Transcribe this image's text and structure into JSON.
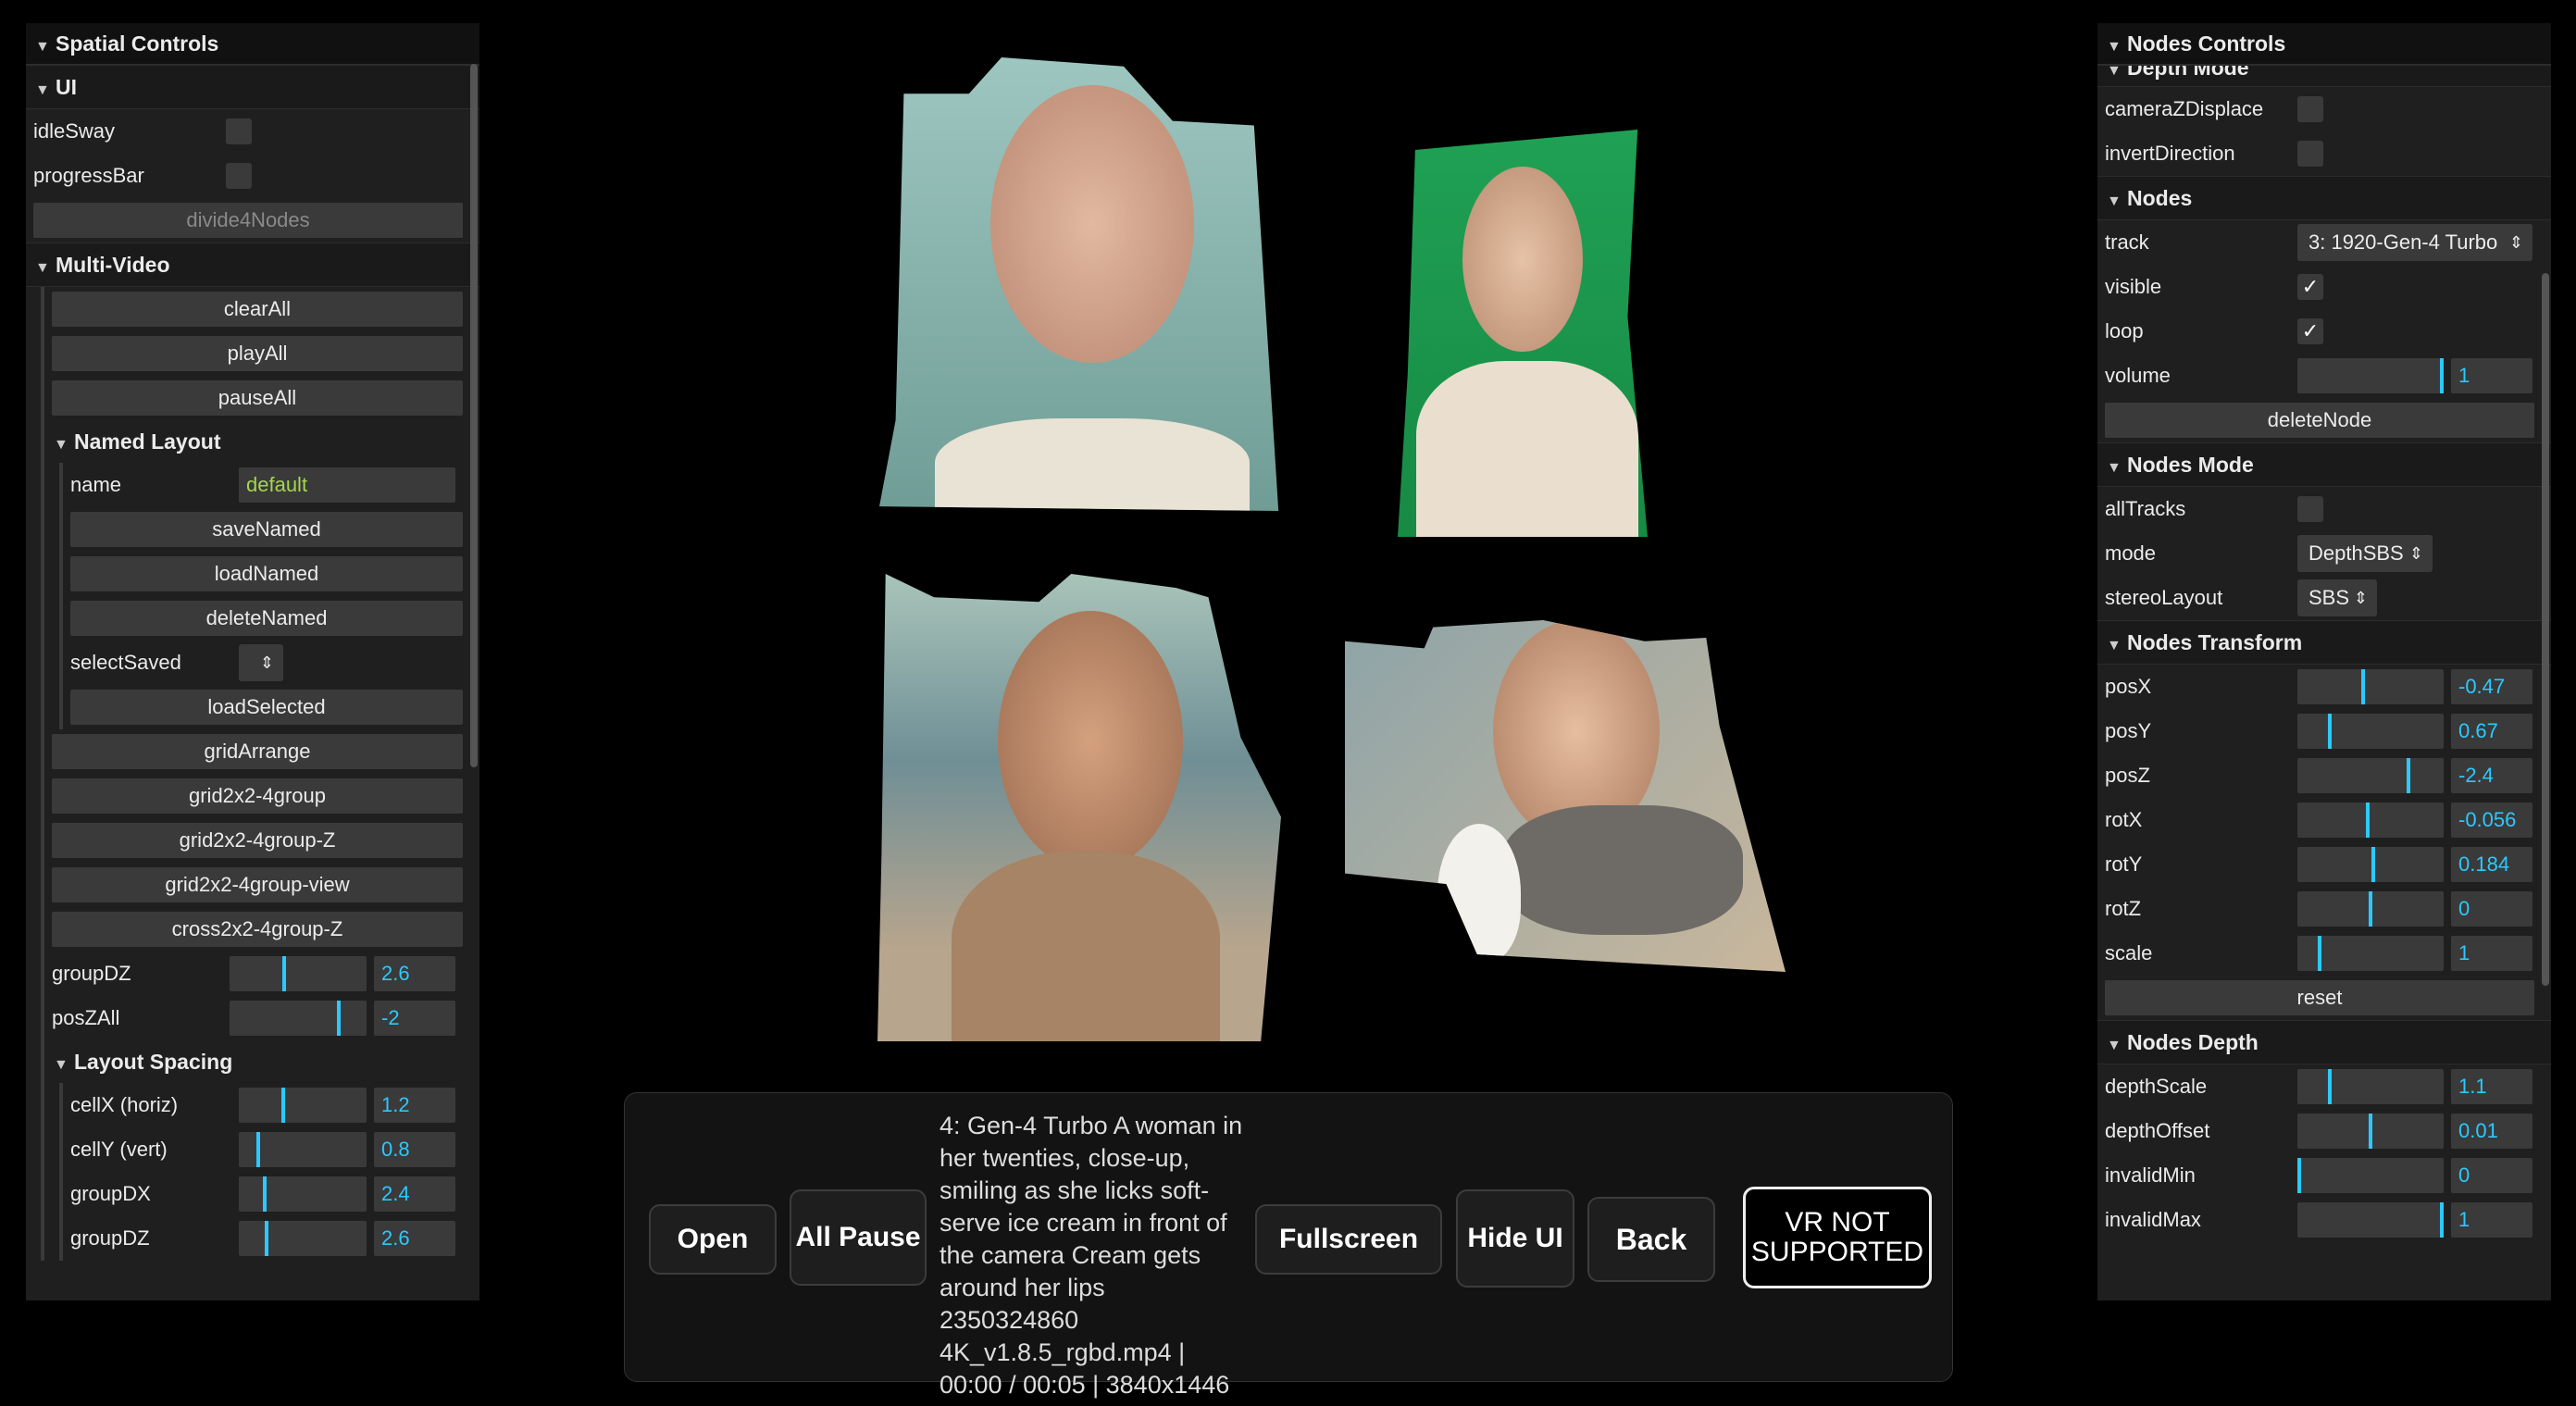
{
  "left_panel": {
    "title": "Spatial Controls",
    "ui_folder": {
      "title": "UI",
      "idleSway_label": "idleSway",
      "progressBar_label": "progressBar",
      "divide_button": "divide4Nodes"
    },
    "multi_video": {
      "title": "Multi-Video",
      "buttons": [
        "clearAll",
        "playAll",
        "pauseAll"
      ],
      "named_layout": {
        "title": "Named Layout",
        "name_label": "name",
        "name_value": "default",
        "buttons": [
          "saveNamed",
          "loadNamed",
          "deleteNamed"
        ],
        "selectSaved_label": "selectSaved",
        "load_selected": "loadSelected"
      },
      "layout_buttons": [
        "gridArrange",
        "grid2x2-4group",
        "grid2x2-4group-Z",
        "grid2x2-4group-view",
        "cross2x2-4group-Z"
      ],
      "groupDZ": {
        "label": "groupDZ",
        "value": "2.6",
        "fraction": 0.4
      },
      "posZAll": {
        "label": "posZAll",
        "value": "-2",
        "fraction": 0.8
      },
      "layout_spacing": {
        "title": "Layout Spacing",
        "rows": [
          {
            "label": "cellX (horiz)",
            "value": "1.2",
            "fraction": 0.35
          },
          {
            "label": "cellY (vert)",
            "value": "0.8",
            "fraction": 0.15
          },
          {
            "label": "groupDX",
            "value": "2.4",
            "fraction": 0.2
          },
          {
            "label": "groupDZ",
            "value": "2.6",
            "fraction": 0.22
          }
        ]
      }
    }
  },
  "right_panel": {
    "title": "Nodes Controls",
    "depth_mode_title": "Depth Mode",
    "cameraZDisplace_label": "cameraZDisplace",
    "invertDirection_label": "invertDirection",
    "nodes": {
      "title": "Nodes",
      "track_label": "track",
      "track_value": "3: 1920-Gen-4 Turbo",
      "visible_label": "visible",
      "loop_label": "loop",
      "check_mark": "✓",
      "volume_label": "volume",
      "volume_value": "1",
      "volume_fraction": 1.0,
      "delete_button": "deleteNode"
    },
    "nodes_mode": {
      "title": "Nodes Mode",
      "allTracks_label": "allTracks",
      "mode_label": "mode",
      "mode_value": "DepthSBS",
      "stereoLayout_label": "stereoLayout",
      "stereoLayout_value": "SBS"
    },
    "nodes_transform": {
      "title": "Nodes Transform",
      "rows": [
        {
          "label": "posX",
          "value": "-0.47",
          "fraction": 0.45
        },
        {
          "label": "posY",
          "value": "0.67",
          "fraction": 0.22
        },
        {
          "label": "posZ",
          "value": "-2.4",
          "fraction": 0.76
        },
        {
          "label": "rotX",
          "value": "-0.056",
          "fraction": 0.48
        },
        {
          "label": "rotY",
          "value": "0.184",
          "fraction": 0.52
        },
        {
          "label": "rotZ",
          "value": "0",
          "fraction": 0.5
        },
        {
          "label": "scale",
          "value": "1",
          "fraction": 0.15
        }
      ],
      "reset_button": "reset"
    },
    "nodes_depth": {
      "title": "Nodes Depth",
      "rows": [
        {
          "label": "depthScale",
          "value": "1.1",
          "fraction": 0.22
        },
        {
          "label": "depthOffset",
          "value": "0.01",
          "fraction": 0.5
        },
        {
          "label": "invalidMin",
          "value": "0",
          "fraction": 0.0
        },
        {
          "label": "invalidMax",
          "value": "1",
          "fraction": 1.0
        }
      ]
    }
  },
  "bottom_bar": {
    "open": "Open",
    "all_pause": "All Pause",
    "info": "4: Gen-4 Turbo A woman in her twenties, close-up, smiling as she licks soft-serve ice cream in front of the camera Cream gets around her lips 2350324860 4K_v1.8.5_rgbd.mp4 | 00:00 / 00:05 | 3840x1446",
    "fullscreen": "Fullscreen",
    "hide_ui": "Hide UI",
    "back": "Back",
    "vr": "VR NOT SUPPORTED"
  },
  "colors": {
    "accent": "#2cc9ff",
    "panel_bg": "#1f1f1f",
    "control_bg": "#3a3a3a",
    "string_value": "#a5d64c"
  }
}
